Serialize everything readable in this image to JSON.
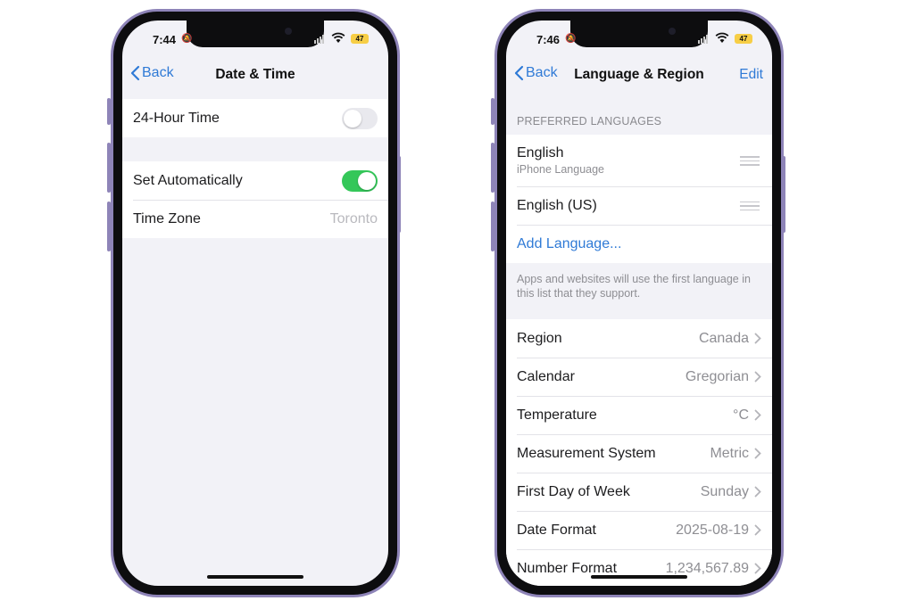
{
  "left_phone": {
    "status": {
      "time": "7:44",
      "battery": "47"
    },
    "nav": {
      "back_label": "Back",
      "title": "Date & Time"
    },
    "hour24": {
      "label": "24-Hour Time",
      "enabled": false
    },
    "set_automatically": {
      "label": "Set Automatically",
      "enabled": true
    },
    "time_zone": {
      "label": "Time Zone",
      "value": "Toronto"
    }
  },
  "right_phone": {
    "status": {
      "time": "7:46",
      "battery": "47"
    },
    "nav": {
      "back_label": "Back",
      "title": "Language & Region",
      "edit_label": "Edit"
    },
    "preferred_header": "PREFERRED LANGUAGES",
    "languages": [
      {
        "name": "English",
        "subtitle": "iPhone Language"
      },
      {
        "name": "English (US)",
        "subtitle": ""
      }
    ],
    "add_language": "Add Language...",
    "footnote": "Apps and websites will use the first language in this list that they support.",
    "settings": [
      {
        "label": "Region",
        "value": "Canada"
      },
      {
        "label": "Calendar",
        "value": "Gregorian"
      },
      {
        "label": "Temperature",
        "value": "°C"
      },
      {
        "label": "Measurement System",
        "value": "Metric"
      },
      {
        "label": "First Day of Week",
        "value": "Sunday"
      },
      {
        "label": "Date Format",
        "value": "2025-08-19"
      },
      {
        "label": "Number Format",
        "value": "1,234,567.89"
      }
    ]
  },
  "colors": {
    "accent": "#2f7ad6",
    "toggle_on": "#34c759",
    "frame": "#8e84b8",
    "battery": "#f7ce46"
  }
}
